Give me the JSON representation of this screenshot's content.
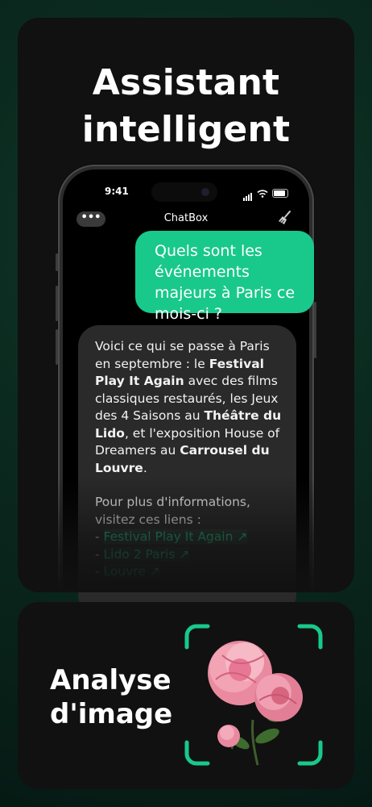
{
  "top_card": {
    "headline_line1": "Assistant",
    "headline_line2": "intelligent"
  },
  "status_bar": {
    "time": "9:41"
  },
  "app_header": {
    "menu_label": "•••",
    "title": "ChatBox",
    "clear_icon": "broom-icon"
  },
  "user_message": {
    "text": "Quels sont les événements majeurs à Paris ce mois-ci ?"
  },
  "bot_message": {
    "p1_a": "Voici ce qui se passe à Paris en septembre : le ",
    "p1_b": "Festival Play It Again",
    "p1_c": " avec des films classiques restaurés, les Jeux des 4 Saisons au ",
    "p1_d": "Théâtre du Lido",
    "p1_e": ", et l'exposition House of Dreamers au ",
    "p1_f": "Carrousel du Louvre",
    "p1_g": ".",
    "p2": "Pour plus d'informations, visitez ces liens :",
    "links": [
      {
        "prefix": "- ",
        "label": "Festival Play It Again ↗"
      },
      {
        "prefix": "- ",
        "label": "Lido 2 Paris ↗"
      },
      {
        "prefix": "- ",
        "label": "Louvre ↗"
      }
    ]
  },
  "bottom_card": {
    "headline_line1": "Analyse",
    "headline_line2": "d'image",
    "image": "pink-peony-flower"
  },
  "colors": {
    "accent": "#18c98b",
    "link": "#2ecf8f",
    "bg_card": "#111111",
    "bubble_bot": "#2a2a2a"
  }
}
